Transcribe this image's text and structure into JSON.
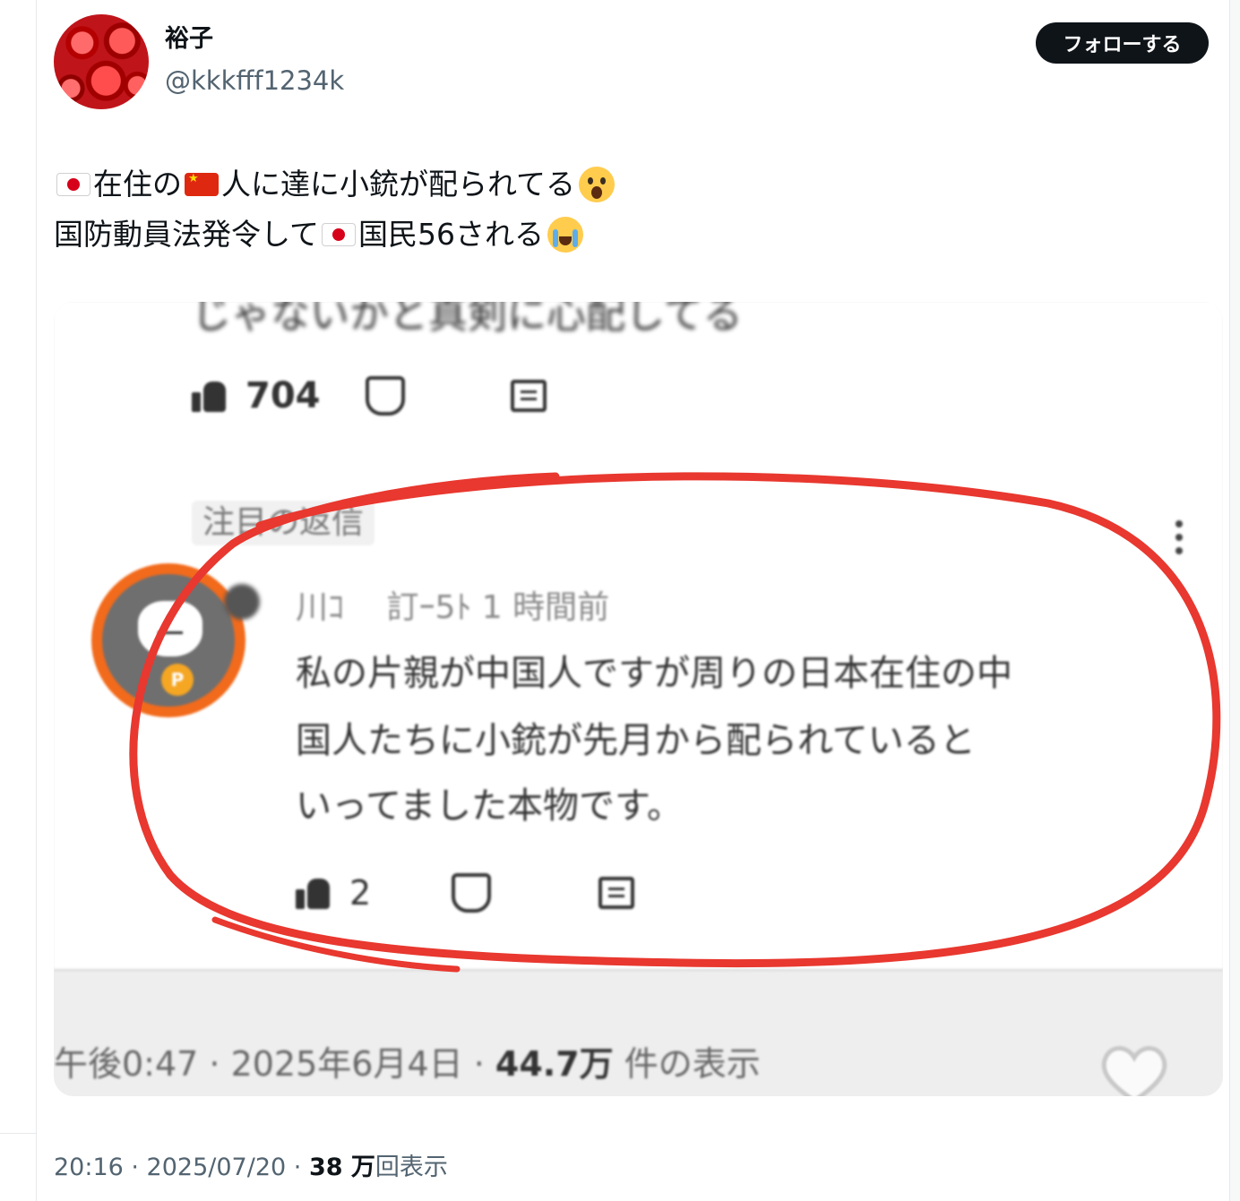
{
  "author": {
    "name": "裕子",
    "handle": "@kkkfff1234k",
    "follow_label": "フォローする"
  },
  "tweet": {
    "line1": {
      "t1": "在住の",
      "t2": "人に達に小銃が配られてる"
    },
    "line2": {
      "t1": "国防動員法発令して",
      "t2": "国民56される"
    }
  },
  "media": {
    "cut_text": "じゃないかと真剣に心配してる",
    "like_count_1": "704",
    "chip": "注目の返信",
    "reply_meta": "川ｺ　 訂ｰ5ﾄ 1 時間前",
    "comment": [
      "私の片親が中国人ですが周りの日本在住の中",
      "国人たちに小銃が先月から配られていると",
      "いってました本物です。"
    ],
    "like_count_2": "2",
    "avatar_badge": "P",
    "footer": {
      "time": "午後0:47 · 2025年6月4日 · ",
      "views": "44.7万",
      "views_suffix": " 件の表示"
    },
    "circle_color": "#e8382f"
  },
  "post_meta": {
    "time": "20:16 · 2025/07/20 · ",
    "views": "38 万",
    "views_suffix": "回表示"
  }
}
